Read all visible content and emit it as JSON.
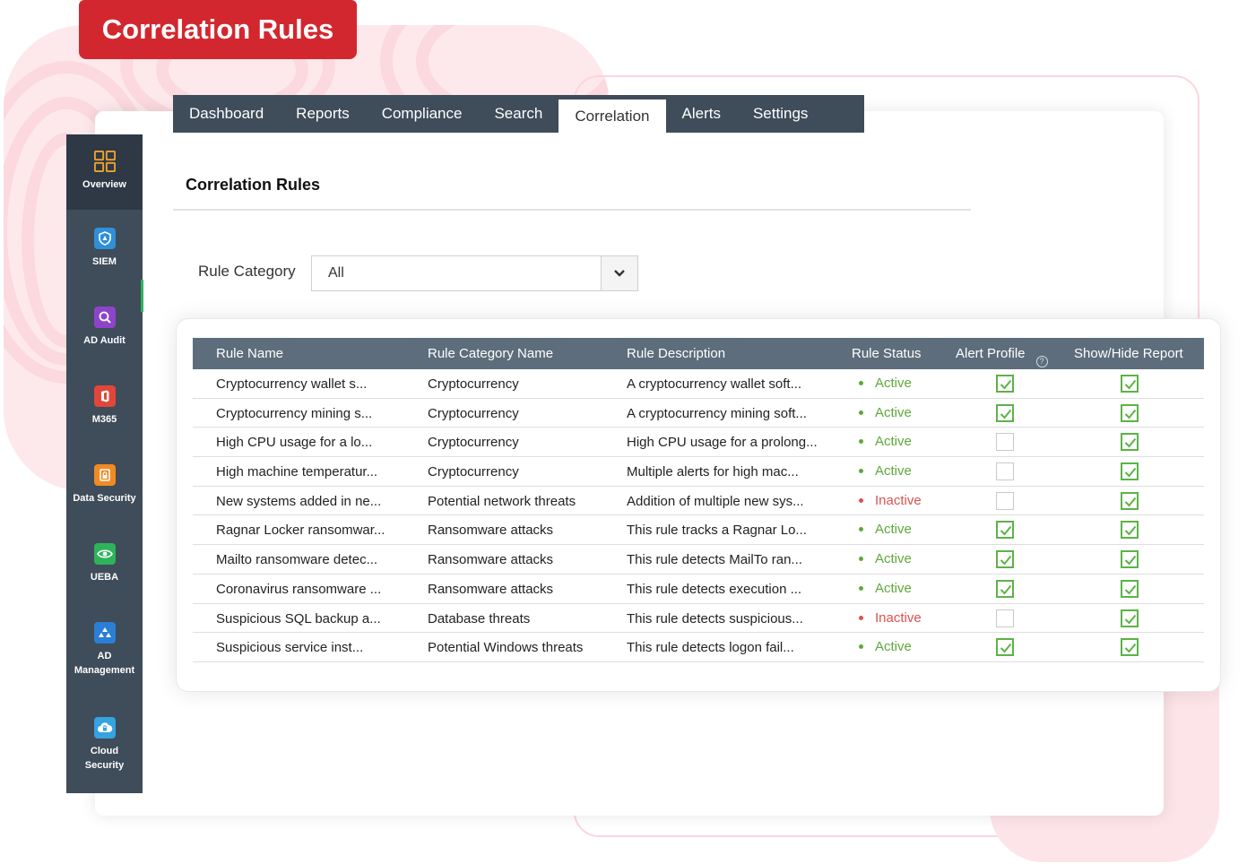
{
  "badge": {
    "title": "Correlation Rules"
  },
  "topnav": {
    "tabs": [
      {
        "label": "Dashboard"
      },
      {
        "label": "Reports"
      },
      {
        "label": "Compliance"
      },
      {
        "label": "Search"
      },
      {
        "label": "Correlation",
        "active": true
      },
      {
        "label": "Alerts"
      },
      {
        "label": "Settings"
      }
    ]
  },
  "sidebar": {
    "items": [
      {
        "label": "Overview",
        "icon": "grid-icon",
        "active": true
      },
      {
        "label": "SIEM",
        "icon": "shield-icon",
        "color": "#2f8fd8"
      },
      {
        "label": "AD Audit",
        "icon": "magnifier-icon",
        "color": "#8e44c9"
      },
      {
        "label": "M365",
        "icon": "office-icon",
        "color": "#e2463a"
      },
      {
        "label": "Data Security",
        "icon": "data-security-icon",
        "color": "#f08a24"
      },
      {
        "label": "UEBA",
        "icon": "eye-icon",
        "color": "#2eb35a"
      },
      {
        "label": "AD\nManagement",
        "icon": "ad-management-icon",
        "color": "#2a7fd4"
      },
      {
        "label": "Cloud\nSecurity",
        "icon": "cloud-lock-icon",
        "color": "#34a3e0"
      }
    ]
  },
  "page": {
    "title": "Correlation Rules"
  },
  "filter": {
    "label": "Rule Category",
    "value": "All"
  },
  "table": {
    "columns": [
      "Rule Name",
      "Rule Category Name",
      "Rule Description",
      "Rule Status",
      "Alert Profile",
      "Show/Hide Report"
    ],
    "help_icon": "?",
    "rows": [
      {
        "name": "Cryptocurrency wallet s...",
        "category": "Cryptocurrency",
        "description": "A cryptocurrency wallet soft...",
        "status": "Active",
        "alert": true,
        "report": true
      },
      {
        "name": "Cryptocurrency mining s...",
        "category": "Cryptocurrency",
        "description": "A cryptocurrency mining soft...",
        "status": "Active",
        "alert": true,
        "report": true
      },
      {
        "name": "High CPU usage for a lo...",
        "category": "Cryptocurrency",
        "description": "High CPU usage for a prolong...",
        "status": "Active",
        "alert": false,
        "report": true
      },
      {
        "name": "High machine temperatur...",
        "category": "Cryptocurrency",
        "description": "Multiple alerts for high mac...",
        "status": "Active",
        "alert": false,
        "report": true
      },
      {
        "name": "New systems added in ne...",
        "category": "Potential network threats",
        "description": "Addition of multiple new sys...",
        "status": "Inactive",
        "alert": false,
        "report": true
      },
      {
        "name": "Ragnar Locker ransomwar...",
        "category": "Ransomware attacks",
        "description": "This rule tracks a Ragnar Lo...",
        "status": "Active",
        "alert": true,
        "report": true
      },
      {
        "name": "Mailto ransomware detec...",
        "category": "Ransomware attacks",
        "description": "This rule detects MailTo ran...",
        "status": "Active",
        "alert": true,
        "report": true
      },
      {
        "name": "Coronavirus ransomware ...",
        "category": "Ransomware attacks",
        "description": "This rule detects execution ...",
        "status": "Active",
        "alert": true,
        "report": true
      },
      {
        "name": "Suspicious SQL backup a...",
        "category": "Database threats",
        "description": "This rule detects suspicious...",
        "status": "Inactive",
        "alert": false,
        "report": true
      },
      {
        "name": "Suspicious service inst...",
        "category": "Potential Windows threats",
        "description": "This rule detects logon fail...",
        "status": "Active",
        "alert": true,
        "report": true
      }
    ]
  },
  "colors": {
    "brand_red": "#d3272f",
    "nav_bg": "#3f4c59",
    "table_header": "#5d6d7b",
    "active_green": "#5fa83b",
    "inactive_red": "#d9534f",
    "checkbox_green": "#5cb346"
  }
}
